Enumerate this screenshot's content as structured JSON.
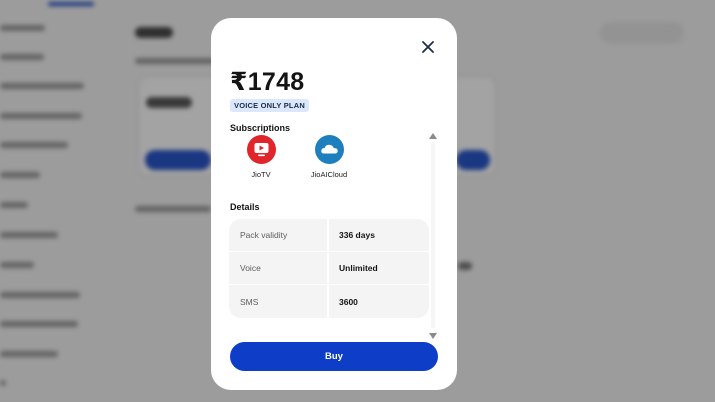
{
  "modal": {
    "price": "₹1748",
    "plan_badge": "VOICE ONLY PLAN",
    "subscriptions_title": "Subscriptions",
    "subscriptions": [
      {
        "label": "JioTV",
        "icon": "jiotv-icon",
        "color": "#e0252b"
      },
      {
        "label": "JioAICloud",
        "icon": "jioaicloud-icon",
        "color": "#1e7fbf"
      }
    ],
    "details_title": "Details",
    "details": [
      {
        "label": "Pack validity",
        "value": "336 days"
      },
      {
        "label": "Voice",
        "value": "Unlimited"
      },
      {
        "label": "SMS",
        "value": "3600"
      }
    ],
    "buy_label": "Buy"
  },
  "colors": {
    "accent": "#0e3dc7",
    "badge_bg": "#dbe8fb",
    "overlay": "rgba(0,0,0,0.36)"
  }
}
